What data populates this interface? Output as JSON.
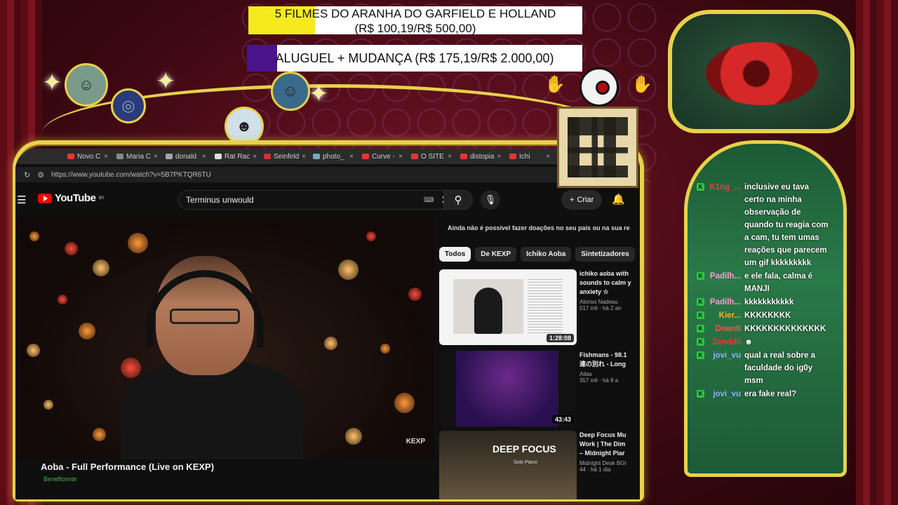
{
  "goals": [
    {
      "line1": "5 FILMES DO ARANHA DO GARFIELD E HOLLAND",
      "line2": "(R$ 100,19/R$ 500,00)",
      "progress": 0.2,
      "color": "#f5ea1e"
    },
    {
      "label": "ALUGUEL + MUDANÇA (R$ 175,19/R$ 2.000,00)",
      "progress": 0.09,
      "color": "#4a148c"
    }
  ],
  "browser": {
    "tabs": [
      {
        "label": "Novo C",
        "color": "#e33"
      },
      {
        "label": "Maria C",
        "color": "#888"
      },
      {
        "label": "donald",
        "color": "#9aa"
      },
      {
        "label": "Rat Rac",
        "color": "#ddd"
      },
      {
        "label": "Seinfeld",
        "color": "#c33"
      },
      {
        "label": "photo_",
        "color": "#7ab"
      },
      {
        "label": "Curve -",
        "color": "#e33"
      },
      {
        "label": "O SITE",
        "color": "#e33"
      },
      {
        "label": "distopia",
        "color": "#e33"
      },
      {
        "label": "Ichi",
        "color": "#e33"
      }
    ],
    "url": "https://www.youtube.com/watch?v=5B7PKTQR6TU"
  },
  "youtube": {
    "logo_text": "YouTube",
    "region": "BR",
    "search_value": "Terminus unwould",
    "create_label": "Criar",
    "video_title": "Aoba - Full Performance (Live on KEXP)",
    "channel_sub": "Beneficente",
    "player_mark": "KEXP",
    "donate_note": "Ainda não é possível fazer doações no seu país ou na sua re",
    "chips": [
      "Todos",
      "De KEXP",
      "Ichiko Aoba",
      "Sintetizadores"
    ],
    "recommendations": [
      {
        "title1": "ichiko aoba with",
        "title2": "sounds to calm y",
        "title3": "anxiety ☆",
        "channel": "Alonso Nadeau",
        "views": "517 mil · há 2 an",
        "duration": "1:28:08"
      },
      {
        "title1": "Fishmans - 98.1",
        "title2": "連の別れ - Long",
        "title3": "",
        "channel": "Atlas",
        "views": "357 mil · há 9 a",
        "duration": "43:43"
      },
      {
        "title1": "Deep Focus Mu",
        "title2": "Work | The Dim",
        "title3": "– Midnight Piar",
        "channel": "Midnight Desk BGI",
        "views": "44 · há 1 dia",
        "duration": "",
        "thumb_title": "DEEP FOCUS",
        "thumb_sub": "Solo Piano"
      }
    ]
  },
  "chat": [
    {
      "user": "K1ng_...",
      "color": "#e04040",
      "text": "inclusive eu tava certo na minha observação de quando tu reagia com a cam, tu tem umas reações que parecem um gif kkkkkkkkk"
    },
    {
      "user": "Padilh...",
      "color": "#ff9ad5",
      "text": "e ele fala, calma é MANJI"
    },
    {
      "user": "Padilh...",
      "color": "#ff9ad5",
      "text": "kkkkkkkkkkk"
    },
    {
      "user": "Kier...",
      "color": "#ffb020",
      "text": "KKKKKKKK"
    },
    {
      "user": "DoardI",
      "color": "#ff5050",
      "text": "KKKKKKKKKKKKKK"
    },
    {
      "user": "Zenddii",
      "color": "#ff3030",
      "text": "☻"
    },
    {
      "user": "jovi_vu",
      "color": "#8ab4ff",
      "text": "qual a real sobre a faculdade do ig0y msm"
    },
    {
      "user": "jovi_vu",
      "color": "#8ab4ff",
      "text": "era fake real?"
    }
  ]
}
